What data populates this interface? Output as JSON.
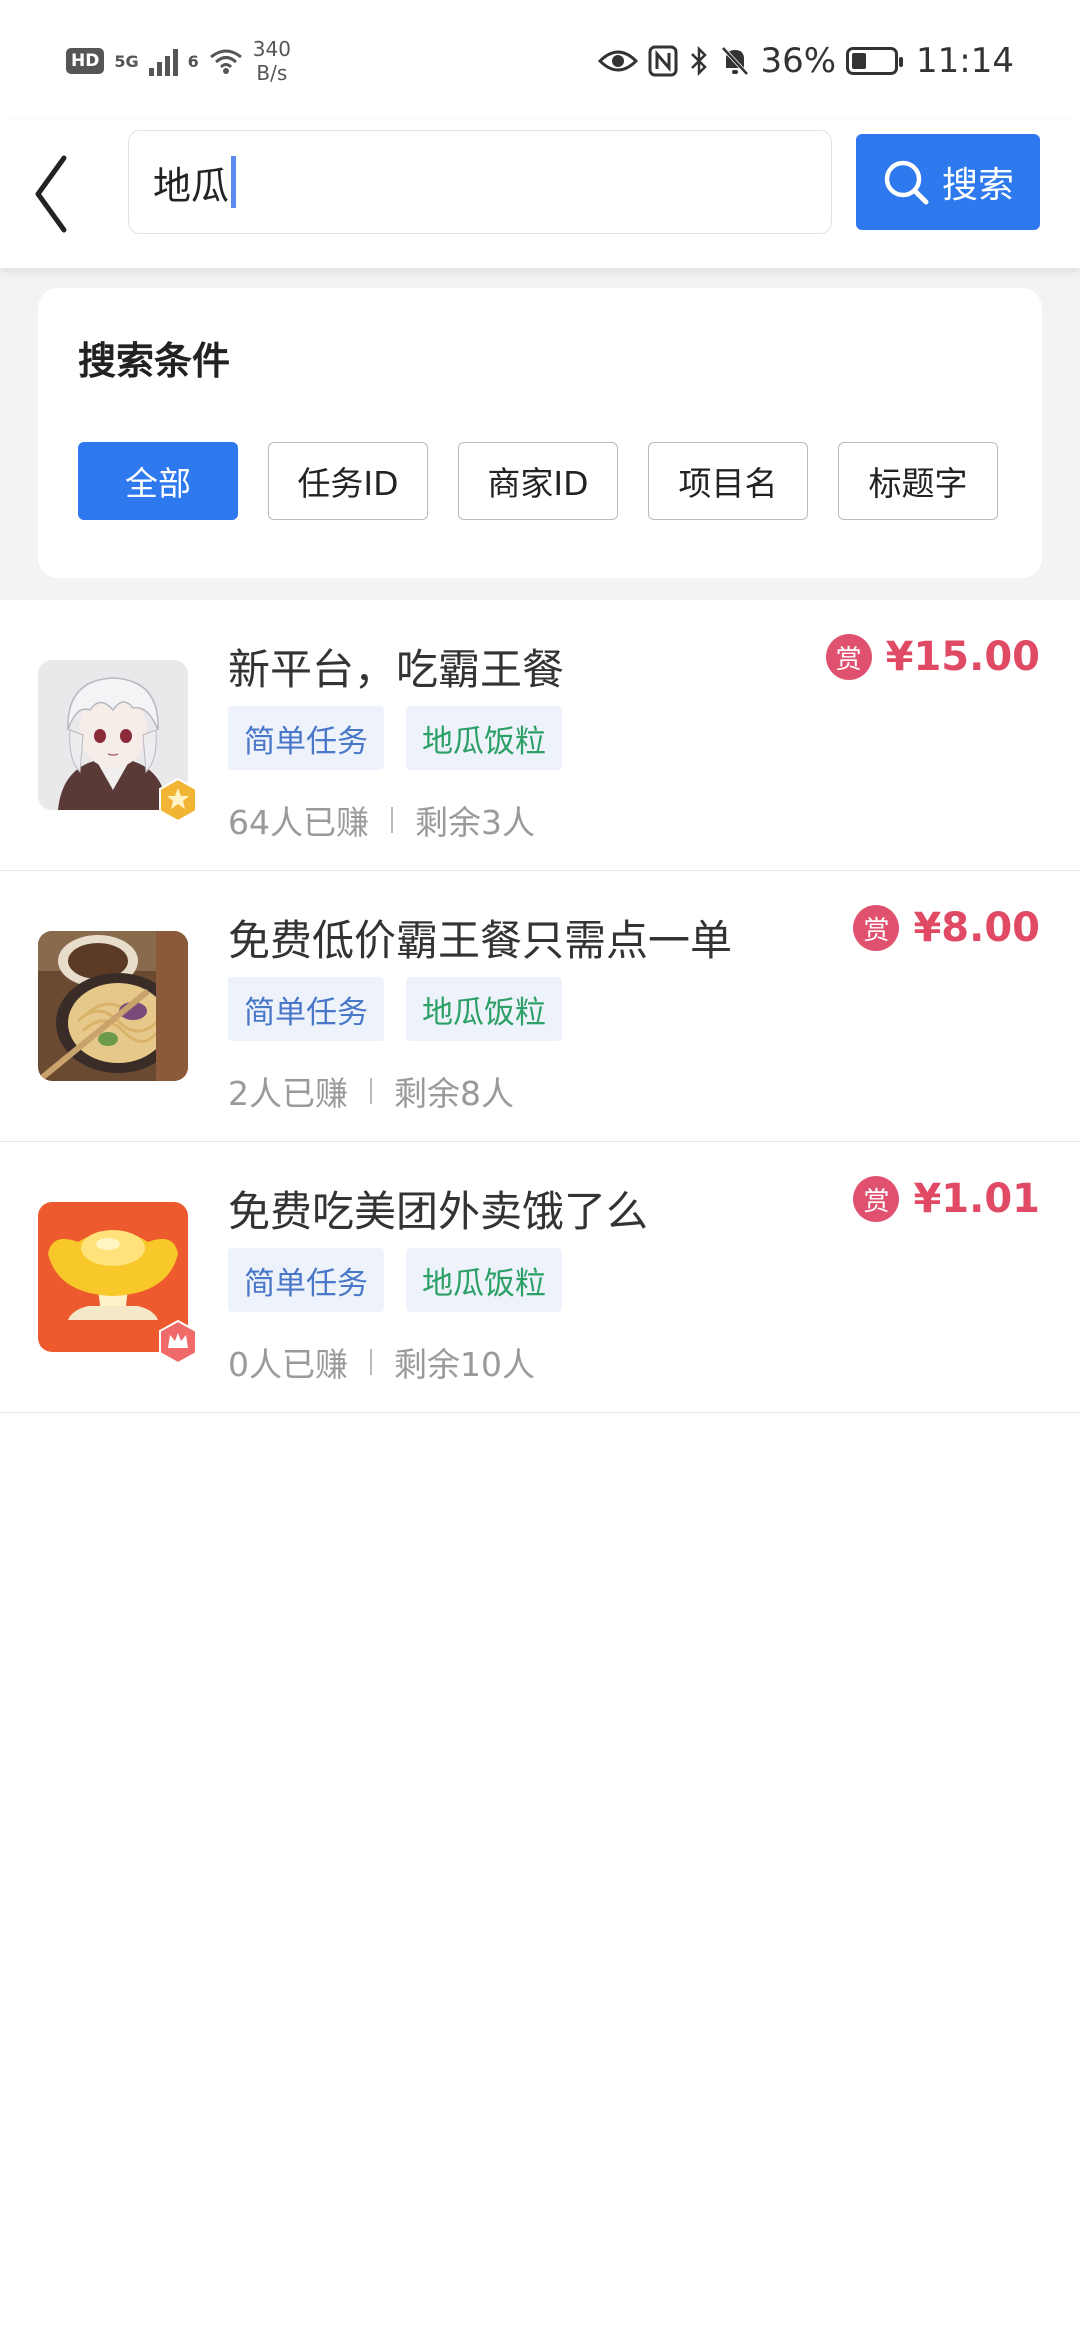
{
  "status_bar": {
    "hd": "HD",
    "network_5g": "5G",
    "network_6": "6",
    "speed_value": "340",
    "speed_unit": "B/s",
    "battery_percent": "36%",
    "battery_level": 0.36,
    "time": "11:14"
  },
  "search": {
    "query": "地瓜",
    "button_label": "搜索"
  },
  "filter": {
    "title": "搜索条件",
    "options": [
      "全部",
      "任务ID",
      "商家ID",
      "项目名",
      "标题字"
    ],
    "selected": "全部"
  },
  "results": [
    {
      "title": "新平台，吃霸王餐",
      "reward_icon": "赏",
      "reward": "¥15.00",
      "tags": [
        "简单任务",
        "地瓜饭粒"
      ],
      "earned": "64人已赚",
      "remaining": "剩余3人",
      "thumbnail": "anime-avatar",
      "badge": "gold-star-badge"
    },
    {
      "title": "免费低价霸王餐只需点一单",
      "reward_icon": "赏",
      "reward": "¥8.00",
      "tags": [
        "简单任务",
        "地瓜饭粒"
      ],
      "earned": "2人已赚",
      "remaining": "剩余8人",
      "thumbnail": "noodle-bowl-photo",
      "badge": ""
    },
    {
      "title": "免费吃美团外卖饿了么",
      "reward_icon": "赏",
      "reward": "¥1.01",
      "tags": [
        "简单任务",
        "地瓜饭粒"
      ],
      "earned": "0人已赚",
      "remaining": "剩余10人",
      "thumbnail": "gold-ingot-logo",
      "badge": "red-crown-badge"
    }
  ],
  "colors": {
    "primary": "#2f79ee",
    "reward": "#e04a64",
    "tag_blue": "#4a78c8",
    "tag_green": "#2da067"
  }
}
